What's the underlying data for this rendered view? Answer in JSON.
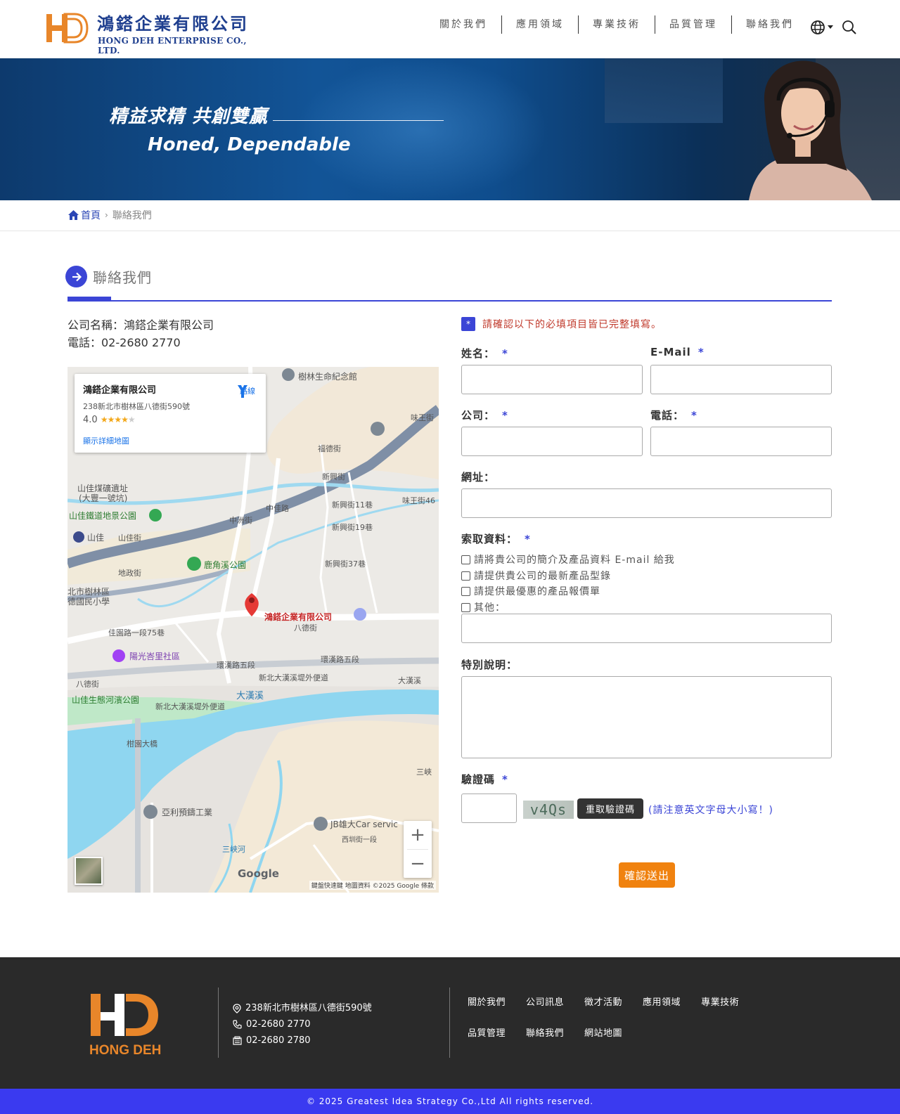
{
  "header": {
    "logo_cn": "鴻鎝企業有限公司",
    "logo_en": "HONG DEH ENTERPRISE CO., LTD.",
    "nav": [
      "關於我們",
      "應用領域",
      "專業技術",
      "品質管理",
      "聯絡我們"
    ],
    "colors": {
      "brand_blue": "#1f3f8f",
      "brand_orange": "#e8862a"
    }
  },
  "banner": {
    "slogan_cn": "精益求精 共創雙贏",
    "slogan_en": "Honed, Dependable"
  },
  "breadcrumb": {
    "home": "首頁",
    "current": "聯絡我們"
  },
  "section": {
    "title": "聯絡我們"
  },
  "company": {
    "name_line": "公司名稱：鴻鎝企業有限公司",
    "phone_line": "電話：02-2680 2770"
  },
  "map": {
    "card_title": "鴻鎝企業有限公司",
    "card_address": "238新北市樹林區八德街590號",
    "rating": "4.0",
    "details_link": "顯示詳細地圖",
    "route_label": "路線",
    "marker_label": "鴻鎝企業有限公司",
    "labels": [
      "樹林生命紀念館",
      "山佳煤礦遺址",
      "(大豐一號坑)",
      "山佳鐵道地景公園",
      "山佳",
      "山佳街",
      "鹿角溪公園",
      "地政街",
      "佳園路一段75巷",
      "陽光峇里社區",
      "環漢路五段",
      "環漢路五段",
      "新北大漢溪堤外便道",
      "新北大漢溪堤外便道",
      "大漢溪",
      "八德街",
      "八德街",
      "山佳生態河濱公園",
      "柑園大橋",
      "亞利預鑄工業",
      "JB雄大Car servic",
      "西圳街一段",
      "中佳路",
      "中洲街",
      "新興街",
      "福德街",
      "新興街11巷",
      "新興街19巷",
      "新興街37巷",
      "味王街46",
      "味王街",
      "北市樹林區",
      "德國民小學",
      "大漢溪",
      "三峽",
      "三峽河"
    ],
    "google": "Google",
    "footer": "鍵盤快速鍵 地圖資料 ©2025 Google 條款",
    "zoom_in": "+",
    "zoom_out": "−"
  },
  "form": {
    "notice_mark": "*",
    "notice": "請確認以下的必填項目皆已完整填寫。",
    "required_mark": "*",
    "name_label": "姓名：",
    "email_label": "E-Mail",
    "company_label": "公司：",
    "phone_label": "電話：",
    "website_label": "網址：",
    "request_label": "索取資料：",
    "options": [
      "請將貴公司的簡介及產品資料 E-mail 給我",
      "請提供貴公司的最新產品型錄",
      "請提供最優惠的產品報價單",
      "其他："
    ],
    "notes_label": "特別說明：",
    "captcha_label": "驗證碼",
    "captcha_text": "v4Qs",
    "captcha_refresh": "重取驗證碼",
    "captcha_note": "(請注意英文字母大小寫！)",
    "submit": "確認送出"
  },
  "footer": {
    "logo_text": "HONG DEH",
    "address": "238新北市樹林區八德街590號",
    "phone": "02-2680 2770",
    "fax": "02-2680 2780",
    "links": [
      "關於我們",
      "公司訊息",
      "徵才活動",
      "應用領域",
      "專業技術",
      "品質管理",
      "聯絡我們",
      "網站地圖"
    ],
    "copyright": "© 2025 Greatest Idea Strategy Co.,Ltd All rights reserved.",
    "colors": {
      "footer_bg": "#2a2a2a",
      "copyright_bg": "#3a3af0",
      "accent": "#3b45d6"
    }
  }
}
